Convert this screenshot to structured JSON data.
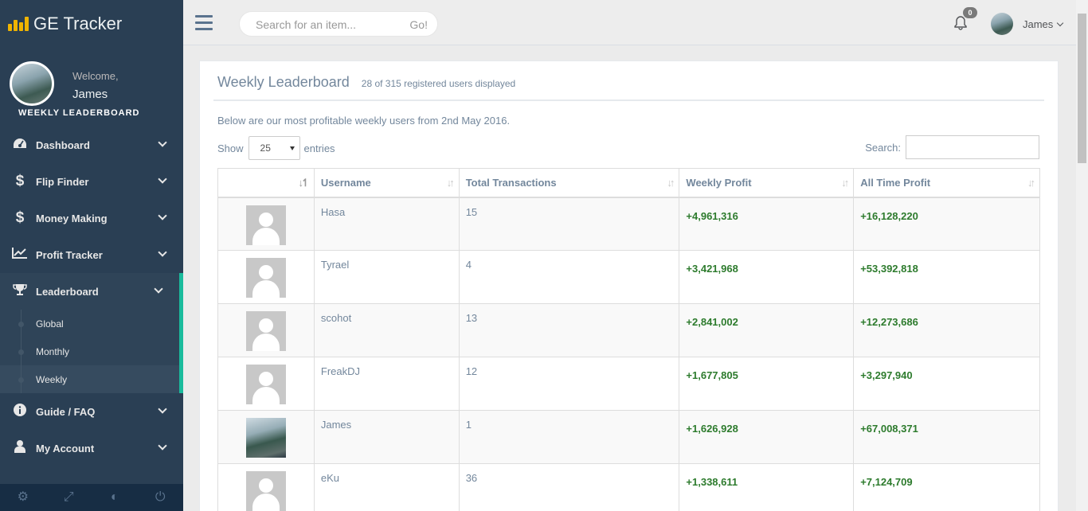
{
  "app": {
    "title": "GE Tracker",
    "section_title": "WEEKLY LEADERBOARD",
    "welcome_text": "Welcome,",
    "username": "James"
  },
  "sidebar": {
    "items": [
      {
        "label": "Dashboard",
        "icon": "dashboard-icon"
      },
      {
        "label": "Flip Finder",
        "icon": "dollar-icon"
      },
      {
        "label": "Money Making",
        "icon": "dollar-icon"
      },
      {
        "label": "Profit Tracker",
        "icon": "line-chart-icon"
      },
      {
        "label": "Leaderboard",
        "icon": "trophy-icon"
      },
      {
        "label": "Guide / FAQ",
        "icon": "info-icon"
      },
      {
        "label": "My Account",
        "icon": "user-icon"
      }
    ],
    "leaderboard_sub": [
      {
        "label": "Global"
      },
      {
        "label": "Monthly"
      },
      {
        "label": "Weekly"
      }
    ],
    "footer_icons": [
      "gear-icon",
      "fullscreen-icon",
      "eye-slash-icon",
      "power-icon"
    ]
  },
  "topnav": {
    "search_placeholder": "Search for an item...",
    "search_button": "Go!",
    "notification_count": "0",
    "user_name": "James"
  },
  "panel": {
    "title": "Weekly Leaderboard",
    "subtitle": "28 of 315 registered users displayed",
    "intro": "Below are our most profitable weekly users from 2nd May 2016.",
    "show_label": "Show",
    "entries_value": "25",
    "entries_label": "entries",
    "search_label": "Search:"
  },
  "table": {
    "columns": [
      "",
      "Username",
      "Total Transactions",
      "Weekly Profit",
      "All Time Profit"
    ],
    "rows": [
      {
        "username": "Hasa",
        "transactions": "15",
        "weekly": "+4,961,316",
        "alltime": "+16,128,220",
        "photo": false
      },
      {
        "username": "Tyrael",
        "transactions": "4",
        "weekly": "+3,421,968",
        "alltime": "+53,392,818",
        "photo": false
      },
      {
        "username": "scohot",
        "transactions": "13",
        "weekly": "+2,841,002",
        "alltime": "+12,273,686",
        "photo": false
      },
      {
        "username": "FreakDJ",
        "transactions": "12",
        "weekly": "+1,677,805",
        "alltime": "+3,297,940",
        "photo": false
      },
      {
        "username": "James",
        "transactions": "1",
        "weekly": "+1,626,928",
        "alltime": "+67,008,371",
        "photo": true
      },
      {
        "username": "eKu",
        "transactions": "36",
        "weekly": "+1,338,611",
        "alltime": "+7,124,709",
        "photo": false
      }
    ]
  },
  "colors": {
    "sidebar_bg": "#2a3f54",
    "accent": "#1abb9c",
    "profit_green": "#2d7b2d"
  }
}
